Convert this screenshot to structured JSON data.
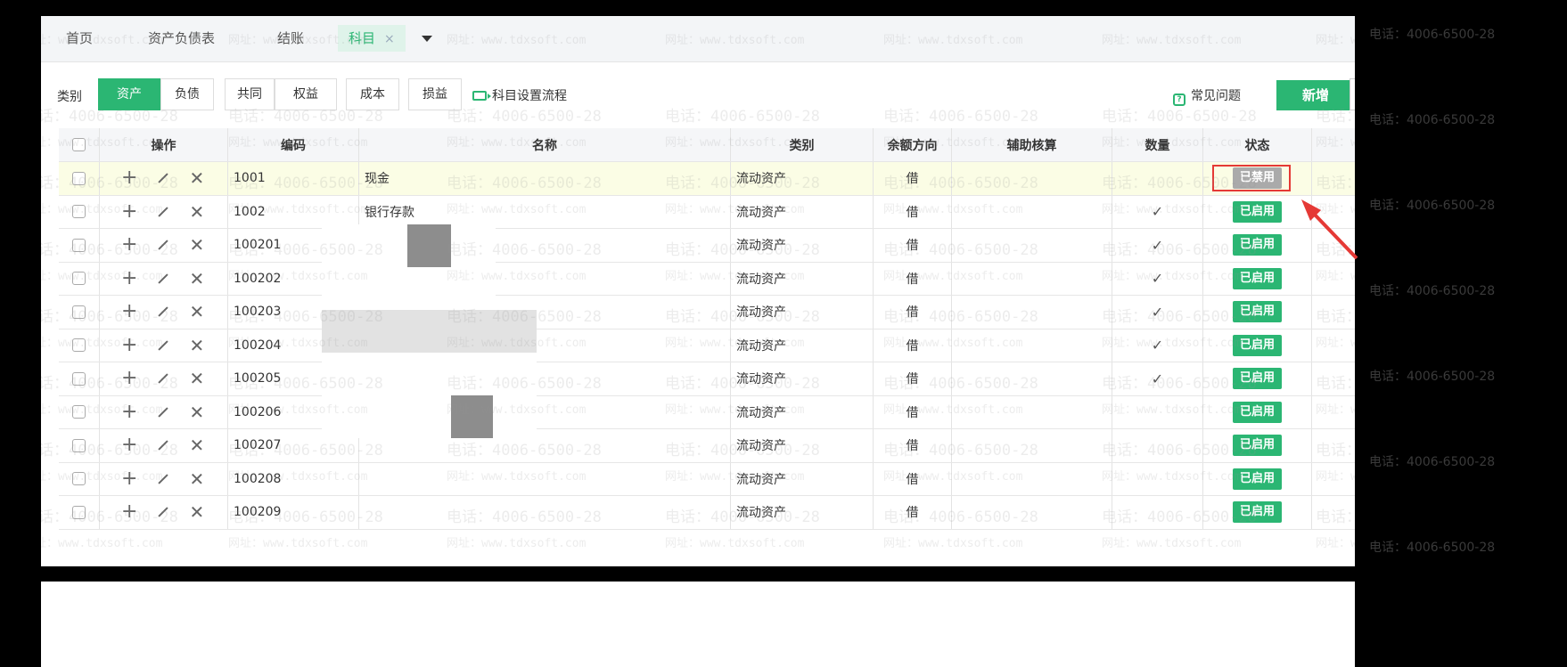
{
  "tabs": [
    {
      "label": "首页",
      "closable": false,
      "active": false
    },
    {
      "label": "资产负债表",
      "closable": false,
      "active": false
    },
    {
      "label": "结账",
      "closable": false,
      "active": false
    },
    {
      "label": "科目",
      "closable": true,
      "active": true
    }
  ],
  "tab_close_glyph": "×",
  "categories": {
    "label": "类别",
    "items": [
      "资产",
      "负债",
      "共同",
      "权益",
      "成本",
      "损益"
    ],
    "active": "资产"
  },
  "toolbar": {
    "flow_link": "科目设置流程",
    "faq_link": "常见问题",
    "new_button": "新增"
  },
  "table": {
    "columns": [
      "操作",
      "编码",
      "名称",
      "类别",
      "余额方向",
      "辅助核算",
      "数量",
      "状态"
    ],
    "rows": [
      {
        "code": "1001",
        "name": "现金",
        "category": "流动资产",
        "direction": "借",
        "aux": "",
        "qty": "",
        "status": "已禁用",
        "enabled": false,
        "highlight": true
      },
      {
        "code": "1002",
        "name": "银行存款",
        "category": "流动资产",
        "direction": "借",
        "aux": "",
        "qty": "✓",
        "status": "已启用",
        "enabled": true
      },
      {
        "code": "100201",
        "name": "",
        "category": "流动资产",
        "direction": "借",
        "aux": "",
        "qty": "✓",
        "status": "已启用",
        "enabled": true
      },
      {
        "code": "100202",
        "name": "",
        "category": "流动资产",
        "direction": "借",
        "aux": "",
        "qty": "✓",
        "status": "已启用",
        "enabled": true
      },
      {
        "code": "100203",
        "name": "",
        "category": "流动资产",
        "direction": "借",
        "aux": "",
        "qty": "✓",
        "status": "已启用",
        "enabled": true
      },
      {
        "code": "100204",
        "name": "",
        "category": "流动资产",
        "direction": "借",
        "aux": "",
        "qty": "✓",
        "status": "已启用",
        "enabled": true
      },
      {
        "code": "100205",
        "name": "",
        "category": "流动资产",
        "direction": "借",
        "aux": "",
        "qty": "✓",
        "status": "已启用",
        "enabled": true
      },
      {
        "code": "100206",
        "name": "",
        "category": "流动资产",
        "direction": "借",
        "aux": "",
        "qty": "",
        "status": "已启用",
        "enabled": true
      },
      {
        "code": "100207",
        "name": "",
        "category": "流动资产",
        "direction": "借",
        "aux": "",
        "qty": "",
        "status": "已启用",
        "enabled": true
      },
      {
        "code": "100208",
        "name": "",
        "category": "流动资产",
        "direction": "借",
        "aux": "",
        "qty": "",
        "status": "已启用",
        "enabled": true
      },
      {
        "code": "100209",
        "name": "",
        "category": "流动资产",
        "direction": "借",
        "aux": "",
        "qty": "",
        "status": "已启用",
        "enabled": true
      }
    ]
  },
  "watermark": {
    "phone": "电话：4006-6500-28",
    "url": "网址：www.tdxsoft.com"
  },
  "colors": {
    "accent": "#2bb673",
    "disabled_badge": "#aaaaaa",
    "highlight_row": "#fbfde5",
    "annotation": "#e53935"
  }
}
